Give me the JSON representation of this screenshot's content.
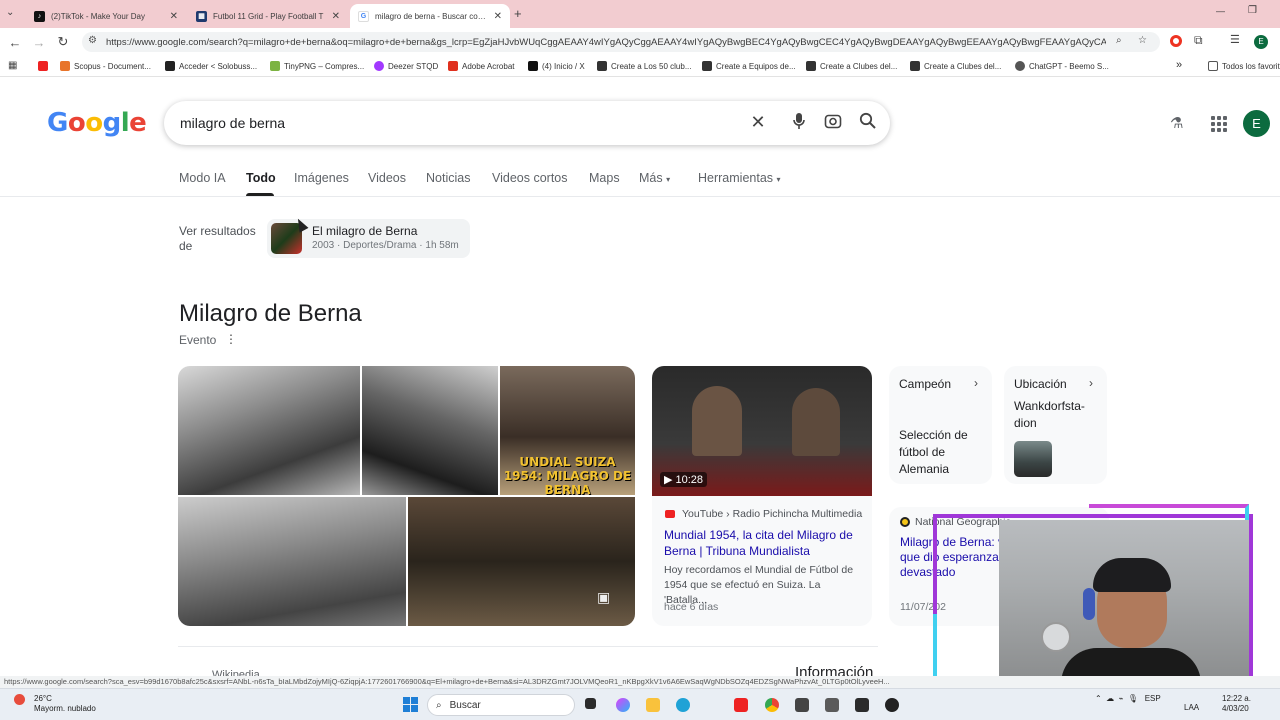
{
  "browser": {
    "tabs": [
      {
        "title": "(2)TikTok - Make Your Day",
        "favicon": "tiktok-icon",
        "active": false
      },
      {
        "title": "Futbol 11 Grid - Play Football T",
        "favicon": "grid-icon",
        "active": false
      },
      {
        "title": "milagro de berna - Buscar con G",
        "favicon": "google-icon",
        "active": true
      }
    ],
    "new_tab_symbol": "+",
    "window_controls": {
      "minimize": "—",
      "maximize": "❐"
    },
    "url": "https://www.google.com/search?q=milagro+de+berna&oq=milagro+de+berna&gs_lcrp=EgZjaHJvbWUqCggAEAAY4wIYgAQyCggAEAAY4wIYgAQyBwgBEC4YgAQyBwgCEC4YgAQyBwgDEAAYgAQyBwgEEAAYgAQyBwgFEAAYgAQyCAgGEA...",
    "bookmarks": [
      {
        "label": "",
        "color": "#e22"
      },
      {
        "label": "Scopus - Document...",
        "color": "#e8742a"
      },
      {
        "label": "Acceder < Solobuss...",
        "color": "#222"
      },
      {
        "label": "TinyPNG – Compres...",
        "color": "#7cb342"
      },
      {
        "label": "Deezer STQD",
        "color": "#a238ff"
      },
      {
        "label": "Adobe Acrobat",
        "color": "#e0301e"
      },
      {
        "label": "(4) Inicio / X",
        "color": "#111"
      },
      {
        "label": "Create a Los 50 club...",
        "color": "#333"
      },
      {
        "label": "Create a Equipos de...",
        "color": "#333"
      },
      {
        "label": "Create a Clubes del...",
        "color": "#333"
      },
      {
        "label": "Create a Clubes del...",
        "color": "#333"
      },
      {
        "label": "ChatGPT - Beemo S...",
        "color": "#555"
      }
    ],
    "bookmarks_more": "»",
    "all_bookmarks": "Todos los favoritos",
    "status_url": "https://www.google.com/search?sca_esv=b99d1670b8afc25c&sxsrf=ANbL-n6sTa_bIaLMbdZojyMIjQ-6ZiqpjA:1772601766900&q=El+milagro+de+Berna&si=AL3DRZGmt7JOLVMQeoR1_nKBpgXkV1v6A6EwSaqWgNDbSOZq4EDZSgNWaPhzvAt_0LTGp0tOlLyveeH..."
  },
  "google": {
    "logo_letters": [
      "G",
      "o",
      "o",
      "g",
      "l",
      "e"
    ],
    "logo_colors": [
      "#4285f4",
      "#ea4335",
      "#fbbc05",
      "#4285f4",
      "#34a853",
      "#ea4335"
    ],
    "query": "milagro de berna",
    "avatar_letter": "E",
    "tabs": [
      {
        "label": "Modo IA",
        "selected": false
      },
      {
        "label": "Todo",
        "selected": true
      },
      {
        "label": "Imágenes",
        "selected": false
      },
      {
        "label": "Videos",
        "selected": false
      },
      {
        "label": "Noticias",
        "selected": false
      },
      {
        "label": "Videos cortos",
        "selected": false
      },
      {
        "label": "Maps",
        "selected": false
      },
      {
        "label": "Más",
        "selected": false
      },
      {
        "label": "Herramientas",
        "selected": false
      }
    ],
    "see_results": {
      "label": "Ver resultados de",
      "title": "El milagro de Berna",
      "meta": "2003 · Deportes/Drama · 1h 58m"
    },
    "knowledge_panel": {
      "title": "Milagro de Berna",
      "subtitle": "Evento",
      "image_overlay_text": "UNDIAL SUIZA 1954: MILAGRO DE BERNA",
      "video": {
        "duration": "10:28",
        "source": "YouTube › Radio Pichincha Multimedia",
        "title": "Mundial 1954, la cita del Milagro de Berna | Tribuna Mundialista",
        "snippet": "Hoy recordamos el Mundial de Fútbol de 1954 que se efectuó en Suiza. La 'Batalla...",
        "date": "hace 6 días"
      },
      "facts": [
        {
          "heading": "Campeón",
          "value": "Selección de fútbol de Alemania"
        },
        {
          "heading": "Ubicación",
          "value": "Wankdorfsta-dion"
        }
      ],
      "article": {
        "source": "National Geographic",
        "title": "Milagro de Berna: victoria deportiva que dio esperanza a un país devastado",
        "date": "11/07/202"
      },
      "bottom_left": "Wikipedia",
      "bottom_right": "Información"
    }
  },
  "taskbar": {
    "weather_temp": "26°C",
    "weather_desc": "Mayorm. nublado",
    "search_label": "Buscar",
    "lang": "ESP",
    "lang2": "LAA",
    "time": "12:22 a.",
    "date": "4/03/20"
  }
}
